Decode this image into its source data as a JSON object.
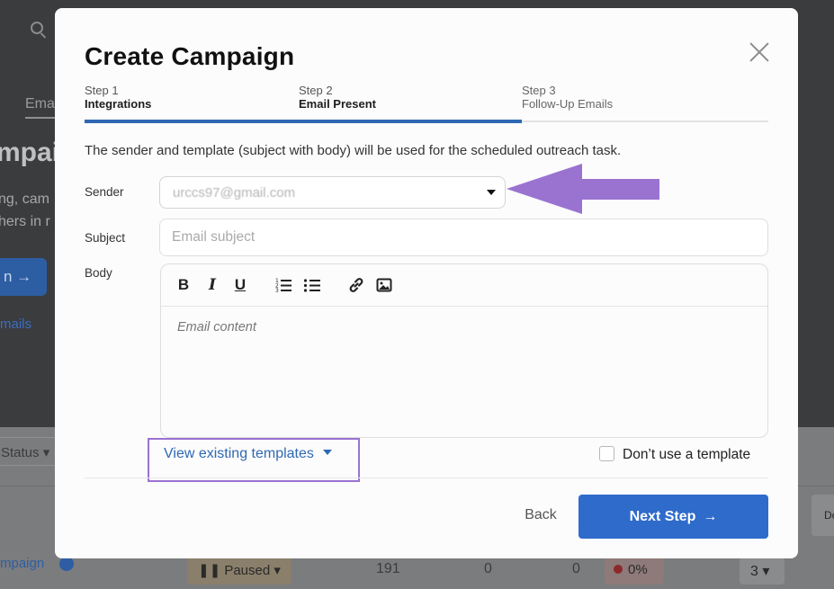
{
  "background": {
    "nav_tab": "Ema",
    "heading": "mpaig",
    "subtext_line1": "ng, cam",
    "subtext_line2": "hers in r",
    "primary_button": "n →",
    "link": "mails",
    "status_filter": "Status",
    "campaign_name": "mpaign",
    "status_badge": "Paused",
    "metrics": [
      "191",
      "0",
      "0"
    ],
    "rate": "0%",
    "count": "3",
    "right_cell": "De"
  },
  "modal": {
    "title": "Create Campaign",
    "steps": [
      {
        "num": "Step 1",
        "label": "Integrations",
        "state": "done"
      },
      {
        "num": "Step 2",
        "label": "Email Present",
        "state": "current"
      },
      {
        "num": "Step 3",
        "label": "Follow-Up Emails",
        "state": "todo"
      }
    ],
    "progress_fraction": 0.64,
    "description": "The sender and template (subject with body) will be used for the scheduled outreach task.",
    "sender": {
      "label": "Sender",
      "value": "urccs97@gmail.com"
    },
    "subject": {
      "label": "Subject",
      "placeholder": "Email subject"
    },
    "body": {
      "label": "Body",
      "placeholder": "Email content",
      "toolbar": [
        "bold",
        "italic",
        "underline",
        "ordered-list",
        "bullet-list",
        "link",
        "image"
      ]
    },
    "templates_link": "View existing templates",
    "no_template_label": "Don’t use a template",
    "back_label": "Back",
    "next_label": "Next Step"
  },
  "colors": {
    "accent": "#2f6bcb",
    "annotation": "#9a73d1"
  }
}
